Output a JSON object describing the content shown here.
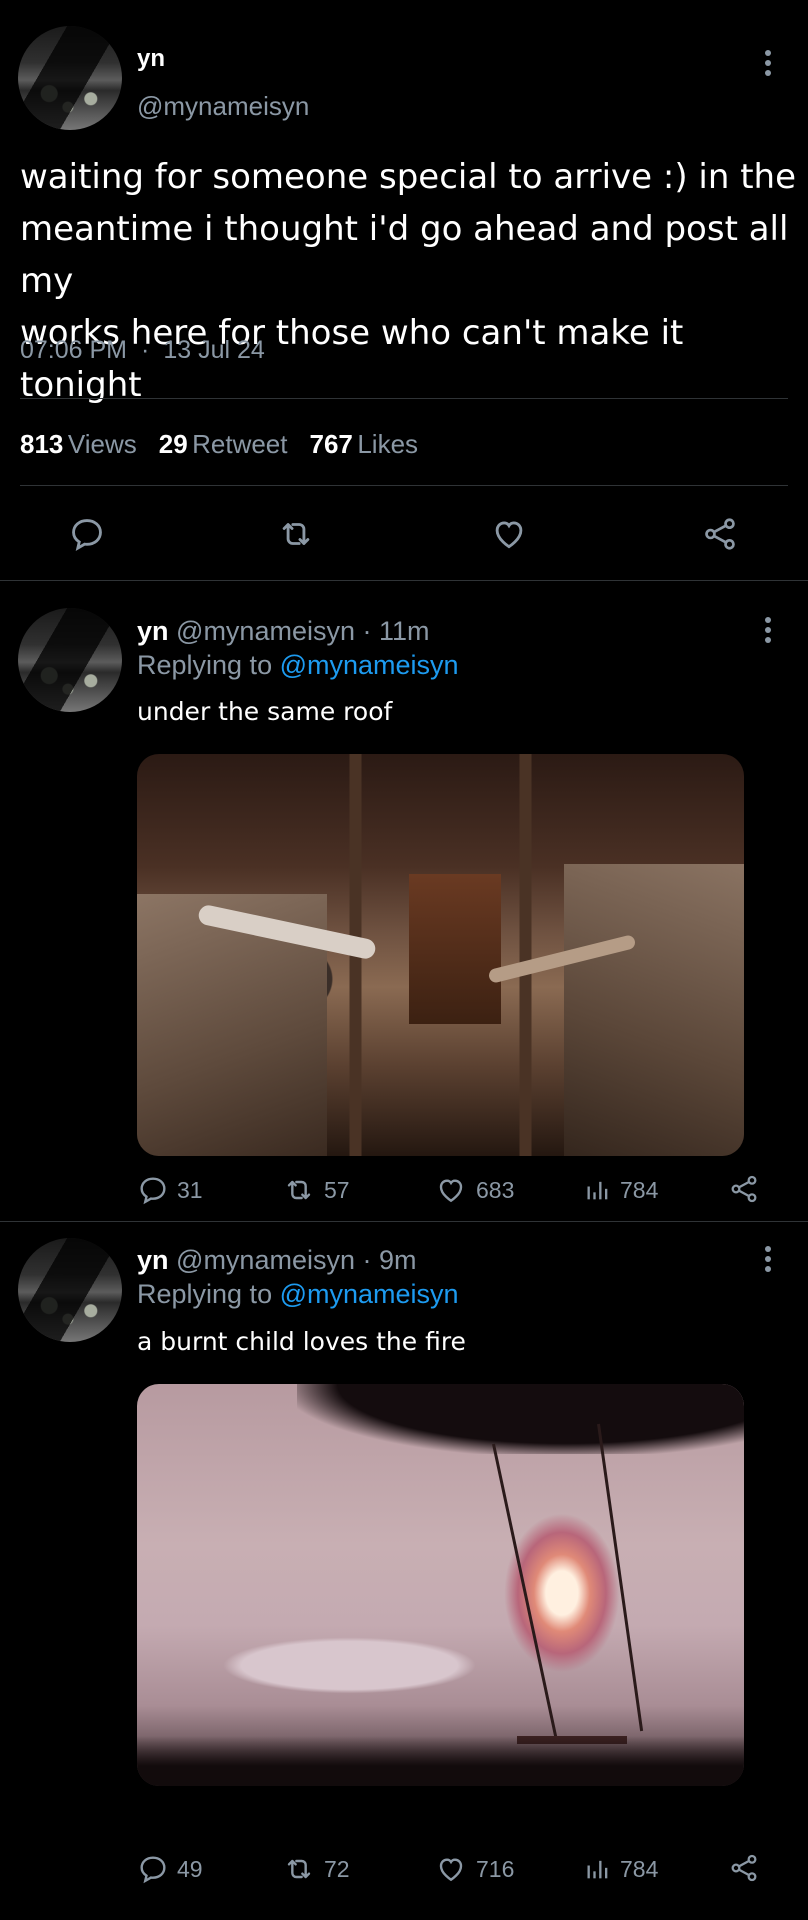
{
  "main_tweet": {
    "display_name": "yn",
    "handle": "@mynameisyn",
    "text_lines": [
      "waiting for someone special to arrive :) in the",
      "meantime i thought i'd go ahead and post all my",
      "works here for those who can't make it tonight"
    ],
    "time": "07:06 PM",
    "dot": "·",
    "date": "13 Jul 24",
    "views_count": "813",
    "views_label": "Views",
    "retweet_count": "29",
    "retweet_label": "Retweet",
    "likes_count": "767",
    "likes_label": "Likes"
  },
  "replies": [
    {
      "display_name": "yn",
      "handle_time": "@mynameisyn · 11m",
      "replying_prefix": "Replying to",
      "mention": "@mynameisyn",
      "text": "under the same roof",
      "image_alt": "two children on separate beds reaching hands toward each other",
      "stats": {
        "replies": "31",
        "retweets": "57",
        "likes": "683",
        "views": "784"
      }
    },
    {
      "display_name": "yn",
      "handle_time": "@mynameisyn · 9m",
      "replying_prefix": "Replying to",
      "mention": "@mynameisyn",
      "text": "a burnt child loves the fire",
      "image_alt": "swing hanging from tree branch engulfed in flames over pink sky",
      "stats": {
        "replies": "49",
        "retweets": "72",
        "likes": "716",
        "views": "784"
      }
    }
  ],
  "colors": {
    "background": "#000000",
    "muted_text": "#8b98a5",
    "mention_blue": "#1d9bf0",
    "divider": "#2f3336"
  },
  "icons": {
    "more": "more-vertical-icon",
    "reply": "speech-bubble-icon",
    "retweet": "retweet-icon",
    "like": "heart-icon",
    "views": "bar-chart-icon",
    "share": "share-icon"
  }
}
